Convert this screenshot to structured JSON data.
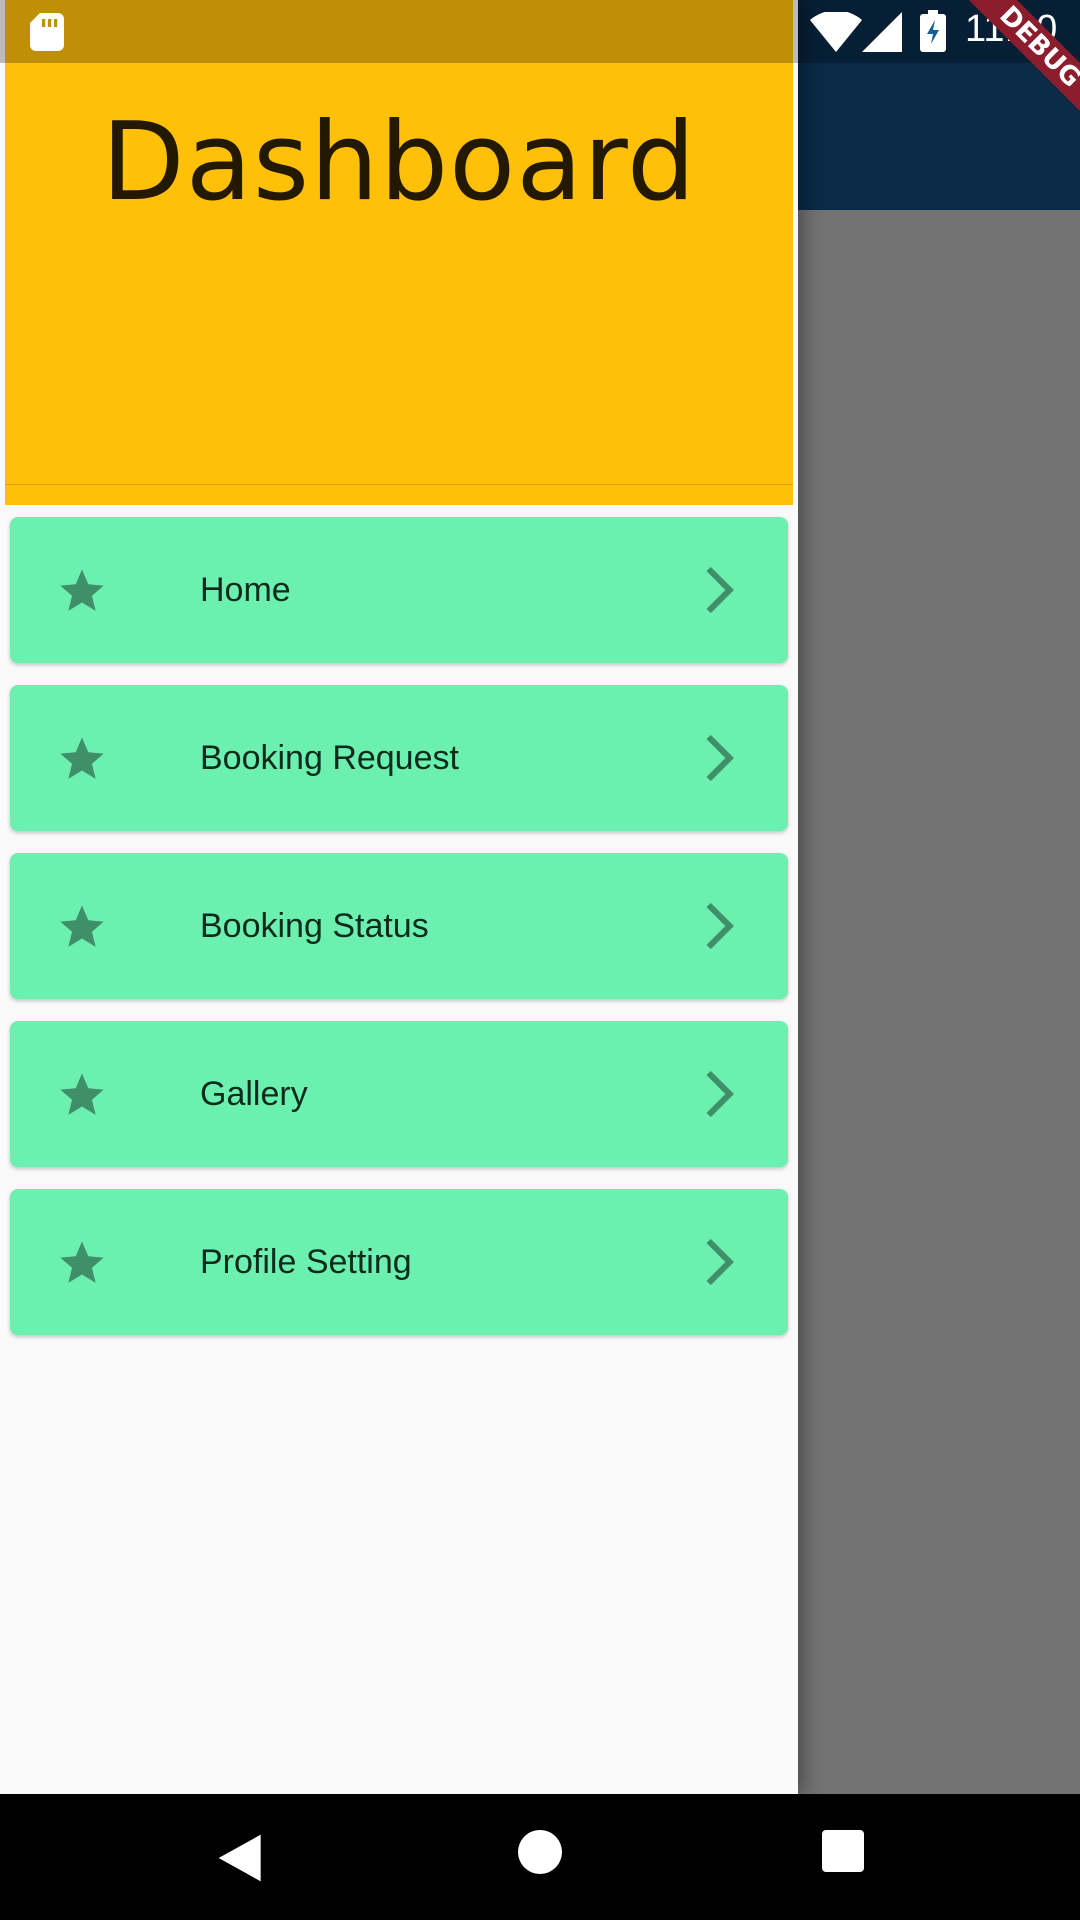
{
  "status_bar": {
    "time": "11:40"
  },
  "debug_banner": "DEBUG",
  "drawer": {
    "header_title": "Dashboard",
    "items": [
      {
        "label": "Home",
        "icon": "star-icon",
        "trailing_icon": "chevron-right-icon"
      },
      {
        "label": "Booking Request",
        "icon": "star-icon",
        "trailing_icon": "chevron-right-icon"
      },
      {
        "label": "Booking Status",
        "icon": "star-icon",
        "trailing_icon": "chevron-right-icon"
      },
      {
        "label": "Gallery",
        "icon": "star-icon",
        "trailing_icon": "chevron-right-icon"
      },
      {
        "label": "Profile Setting",
        "icon": "star-icon",
        "trailing_icon": "chevron-right-icon"
      }
    ]
  },
  "colors": {
    "header": "#ffc107",
    "menu_item": "#6cf0b0",
    "icon": "#3f8f68",
    "app_bar": "#175c9b"
  }
}
